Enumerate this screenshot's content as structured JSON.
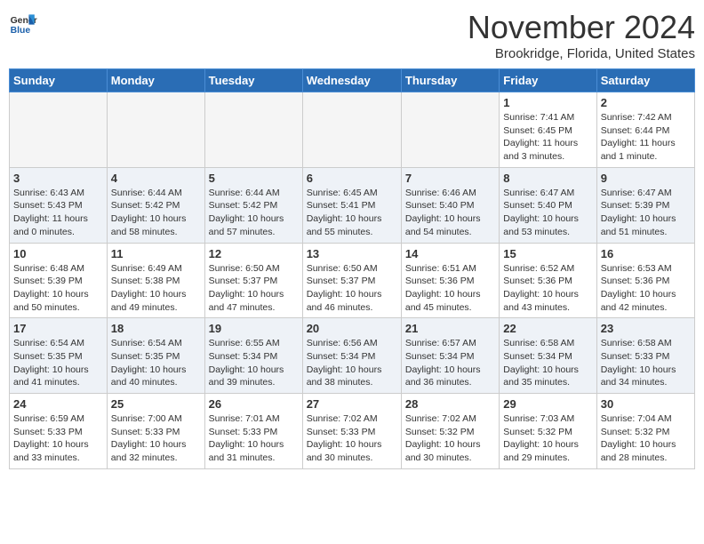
{
  "header": {
    "logo_general": "General",
    "logo_blue": "Blue",
    "month": "November 2024",
    "location": "Brookridge, Florida, United States"
  },
  "days_of_week": [
    "Sunday",
    "Monday",
    "Tuesday",
    "Wednesday",
    "Thursday",
    "Friday",
    "Saturday"
  ],
  "weeks": [
    {
      "stripe": "row-white",
      "days": [
        {
          "num": "",
          "info": "",
          "empty": true
        },
        {
          "num": "",
          "info": "",
          "empty": true
        },
        {
          "num": "",
          "info": "",
          "empty": true
        },
        {
          "num": "",
          "info": "",
          "empty": true
        },
        {
          "num": "",
          "info": "",
          "empty": true
        },
        {
          "num": "1",
          "info": "Sunrise: 7:41 AM\nSunset: 6:45 PM\nDaylight: 11 hours and 3 minutes.",
          "empty": false
        },
        {
          "num": "2",
          "info": "Sunrise: 7:42 AM\nSunset: 6:44 PM\nDaylight: 11 hours and 1 minute.",
          "empty": false
        }
      ]
    },
    {
      "stripe": "row-gray",
      "days": [
        {
          "num": "3",
          "info": "Sunrise: 6:43 AM\nSunset: 5:43 PM\nDaylight: 11 hours and 0 minutes.",
          "empty": false
        },
        {
          "num": "4",
          "info": "Sunrise: 6:44 AM\nSunset: 5:42 PM\nDaylight: 10 hours and 58 minutes.",
          "empty": false
        },
        {
          "num": "5",
          "info": "Sunrise: 6:44 AM\nSunset: 5:42 PM\nDaylight: 10 hours and 57 minutes.",
          "empty": false
        },
        {
          "num": "6",
          "info": "Sunrise: 6:45 AM\nSunset: 5:41 PM\nDaylight: 10 hours and 55 minutes.",
          "empty": false
        },
        {
          "num": "7",
          "info": "Sunrise: 6:46 AM\nSunset: 5:40 PM\nDaylight: 10 hours and 54 minutes.",
          "empty": false
        },
        {
          "num": "8",
          "info": "Sunrise: 6:47 AM\nSunset: 5:40 PM\nDaylight: 10 hours and 53 minutes.",
          "empty": false
        },
        {
          "num": "9",
          "info": "Sunrise: 6:47 AM\nSunset: 5:39 PM\nDaylight: 10 hours and 51 minutes.",
          "empty": false
        }
      ]
    },
    {
      "stripe": "row-white",
      "days": [
        {
          "num": "10",
          "info": "Sunrise: 6:48 AM\nSunset: 5:39 PM\nDaylight: 10 hours and 50 minutes.",
          "empty": false
        },
        {
          "num": "11",
          "info": "Sunrise: 6:49 AM\nSunset: 5:38 PM\nDaylight: 10 hours and 49 minutes.",
          "empty": false
        },
        {
          "num": "12",
          "info": "Sunrise: 6:50 AM\nSunset: 5:37 PM\nDaylight: 10 hours and 47 minutes.",
          "empty": false
        },
        {
          "num": "13",
          "info": "Sunrise: 6:50 AM\nSunset: 5:37 PM\nDaylight: 10 hours and 46 minutes.",
          "empty": false
        },
        {
          "num": "14",
          "info": "Sunrise: 6:51 AM\nSunset: 5:36 PM\nDaylight: 10 hours and 45 minutes.",
          "empty": false
        },
        {
          "num": "15",
          "info": "Sunrise: 6:52 AM\nSunset: 5:36 PM\nDaylight: 10 hours and 43 minutes.",
          "empty": false
        },
        {
          "num": "16",
          "info": "Sunrise: 6:53 AM\nSunset: 5:36 PM\nDaylight: 10 hours and 42 minutes.",
          "empty": false
        }
      ]
    },
    {
      "stripe": "row-gray",
      "days": [
        {
          "num": "17",
          "info": "Sunrise: 6:54 AM\nSunset: 5:35 PM\nDaylight: 10 hours and 41 minutes.",
          "empty": false
        },
        {
          "num": "18",
          "info": "Sunrise: 6:54 AM\nSunset: 5:35 PM\nDaylight: 10 hours and 40 minutes.",
          "empty": false
        },
        {
          "num": "19",
          "info": "Sunrise: 6:55 AM\nSunset: 5:34 PM\nDaylight: 10 hours and 39 minutes.",
          "empty": false
        },
        {
          "num": "20",
          "info": "Sunrise: 6:56 AM\nSunset: 5:34 PM\nDaylight: 10 hours and 38 minutes.",
          "empty": false
        },
        {
          "num": "21",
          "info": "Sunrise: 6:57 AM\nSunset: 5:34 PM\nDaylight: 10 hours and 36 minutes.",
          "empty": false
        },
        {
          "num": "22",
          "info": "Sunrise: 6:58 AM\nSunset: 5:34 PM\nDaylight: 10 hours and 35 minutes.",
          "empty": false
        },
        {
          "num": "23",
          "info": "Sunrise: 6:58 AM\nSunset: 5:33 PM\nDaylight: 10 hours and 34 minutes.",
          "empty": false
        }
      ]
    },
    {
      "stripe": "row-white",
      "days": [
        {
          "num": "24",
          "info": "Sunrise: 6:59 AM\nSunset: 5:33 PM\nDaylight: 10 hours and 33 minutes.",
          "empty": false
        },
        {
          "num": "25",
          "info": "Sunrise: 7:00 AM\nSunset: 5:33 PM\nDaylight: 10 hours and 32 minutes.",
          "empty": false
        },
        {
          "num": "26",
          "info": "Sunrise: 7:01 AM\nSunset: 5:33 PM\nDaylight: 10 hours and 31 minutes.",
          "empty": false
        },
        {
          "num": "27",
          "info": "Sunrise: 7:02 AM\nSunset: 5:33 PM\nDaylight: 10 hours and 30 minutes.",
          "empty": false
        },
        {
          "num": "28",
          "info": "Sunrise: 7:02 AM\nSunset: 5:32 PM\nDaylight: 10 hours and 30 minutes.",
          "empty": false
        },
        {
          "num": "29",
          "info": "Sunrise: 7:03 AM\nSunset: 5:32 PM\nDaylight: 10 hours and 29 minutes.",
          "empty": false
        },
        {
          "num": "30",
          "info": "Sunrise: 7:04 AM\nSunset: 5:32 PM\nDaylight: 10 hours and 28 minutes.",
          "empty": false
        }
      ]
    }
  ]
}
